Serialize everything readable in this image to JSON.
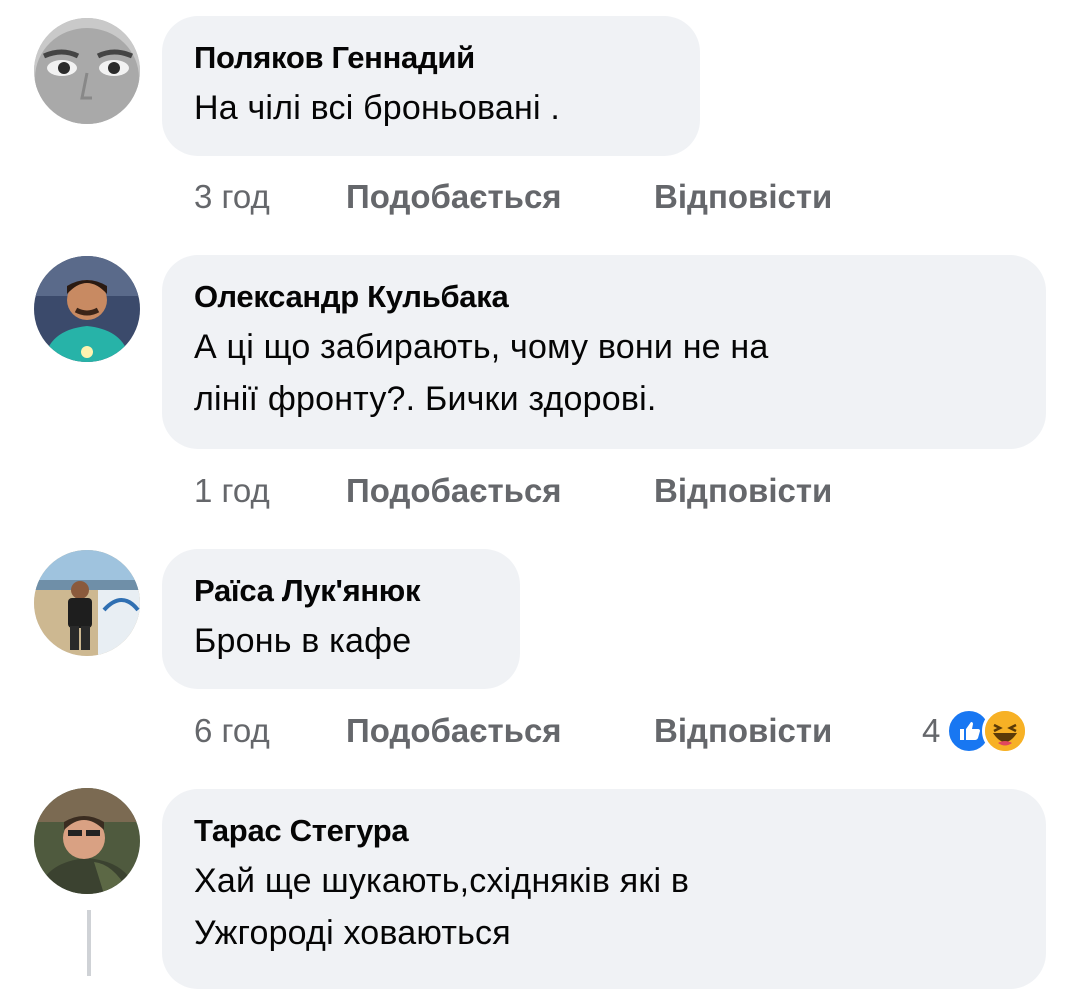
{
  "comments": [
    {
      "author": "Поляков Геннадий",
      "text_lines": [
        "На чілі всі броньовані ."
      ],
      "time": "3 год",
      "like_label": "Подобається",
      "reply_label": "Відповісти"
    },
    {
      "author": "Олександр Кульбака",
      "text_lines": [
        "А ці що забирають, чому вони не на",
        "лінії фронту?. Бички здорові."
      ],
      "time": "1 год",
      "like_label": "Подобається",
      "reply_label": "Відповісти"
    },
    {
      "author": "Раїса Лук'янюк",
      "text_lines": [
        "Бронь в кафе"
      ],
      "time": "6 год",
      "like_label": "Подобається",
      "reply_label": "Відповісти",
      "reaction_count": "4",
      "reaction_icons": [
        "like-icon",
        "haha-icon"
      ]
    },
    {
      "author": "Тарас Стегура",
      "text_lines": [
        "Хай ще шукають,східняків які в",
        "Ужгороді ховаються"
      ]
    }
  ],
  "colors": {
    "bubble": "#f0f2f5",
    "meta_text": "#65676b",
    "like_blue": "#1877f2",
    "haha_yellow": "#f7b125"
  }
}
